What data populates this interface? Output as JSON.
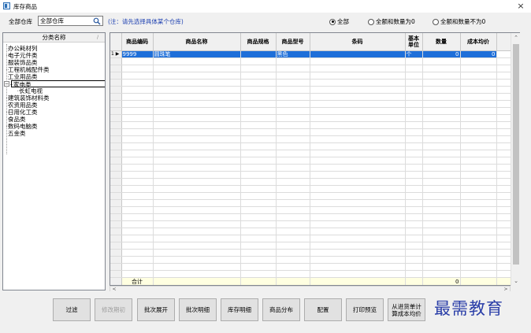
{
  "window": {
    "title": "库存商品",
    "close_glyph": "×"
  },
  "toolbar": {
    "warehouse_label": "全部仓库",
    "warehouse_value": "全部仓库",
    "note": "(注：请先选择具体某个仓库)",
    "radios": [
      {
        "label": "全部",
        "checked": true
      },
      {
        "label": "全额和数量为0",
        "checked": false
      },
      {
        "label": "全额和数量不为0",
        "checked": false
      }
    ]
  },
  "tree": {
    "header": "分类名称",
    "items": [
      {
        "label": "办公耗材列",
        "level": 0
      },
      {
        "label": "电子元件类",
        "level": 0
      },
      {
        "label": "服装饰品类",
        "level": 0
      },
      {
        "label": "工程机械配件类",
        "level": 0
      },
      {
        "label": "工业用品类",
        "level": 0
      },
      {
        "label": "家电类",
        "level": 0,
        "expanded": true,
        "selected": true
      },
      {
        "label": "长虹电视",
        "level": 1
      },
      {
        "label": "建筑装饰材料类",
        "level": 0
      },
      {
        "label": "农资用品类",
        "level": 0
      },
      {
        "label": "日用化工类",
        "level": 0
      },
      {
        "label": "食品类",
        "level": 0
      },
      {
        "label": "数码电脑类",
        "level": 0
      },
      {
        "label": "五金类",
        "level": 0
      }
    ]
  },
  "grid": {
    "columns": [
      "商品编码",
      "商品名称",
      "商品规格",
      "商品型号",
      "条码",
      "基本单位",
      "数量",
      "成本均价"
    ],
    "rows": [
      {
        "row_no": "1",
        "marker": "▶",
        "cells": [
          "9999",
          "圆珠笔",
          "",
          "黑色",
          "",
          "个",
          "0",
          "0"
        ]
      }
    ],
    "total_label": "合计",
    "total_qty": "0"
  },
  "buttons": [
    {
      "label": "过滤",
      "enabled": true
    },
    {
      "label": "修改期初",
      "enabled": false
    },
    {
      "label": "批次展开",
      "enabled": true
    },
    {
      "label": "批次明细",
      "enabled": true
    },
    {
      "label": "库存明细",
      "enabled": true
    },
    {
      "label": "商品分布",
      "enabled": true
    },
    {
      "label": "配置",
      "enabled": true
    },
    {
      "label": "打印预览",
      "enabled": true
    },
    {
      "label": "从进货单计算成本均价",
      "enabled": true
    }
  ],
  "watermark": "最需教育",
  "colors": {
    "selection": "#1e6fd9",
    "total_row": "#ffffe1",
    "note_text": "#1c3fb0"
  }
}
